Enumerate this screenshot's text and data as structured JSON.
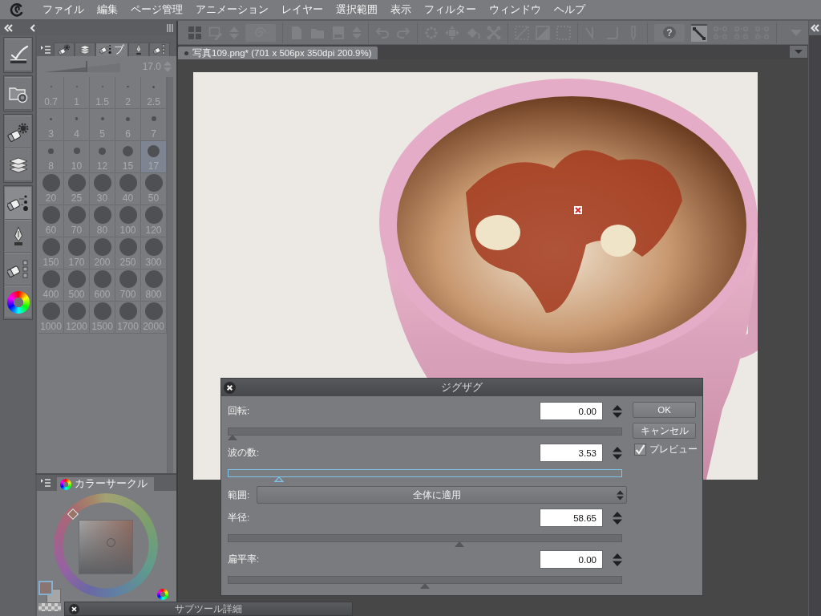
{
  "menu_bar": {
    "items": [
      "ファイル",
      "編集",
      "ページ管理",
      "アニメーション",
      "レイヤー",
      "選択範囲",
      "表示",
      "フィルター",
      "ウィンドウ",
      "ヘルプ"
    ]
  },
  "toolbar": {
    "groups": [
      {
        "items": [
          {
            "kind": "grid",
            "disabled": false
          },
          {
            "kind": "transform",
            "disabled": true
          },
          {
            "kind": "updown",
            "disabled": true
          },
          {
            "kind": "spiral",
            "disabled": true
          }
        ]
      },
      {
        "items": [
          {
            "kind": "new",
            "disabled": true
          },
          {
            "kind": "open",
            "disabled": true
          },
          {
            "kind": "save",
            "disabled": true
          },
          {
            "kind": "updown",
            "disabled": true
          }
        ]
      },
      {
        "items": [
          {
            "kind": "undo",
            "disabled": true
          },
          {
            "kind": "redo",
            "disabled": true
          }
        ]
      },
      {
        "items": [
          {
            "kind": "dots",
            "disabled": true
          },
          {
            "kind": "move",
            "disabled": true
          },
          {
            "kind": "bucket",
            "disabled": true
          },
          {
            "kind": "xshape",
            "disabled": true
          }
        ]
      },
      {
        "items": [
          {
            "kind": "dotted-diagonal",
            "disabled": true
          },
          {
            "kind": "diagonal",
            "disabled": true
          },
          {
            "kind": "dotted-square",
            "disabled": true
          }
        ]
      },
      {
        "items": [
          {
            "kind": "angle",
            "disabled": true
          },
          {
            "kind": "corner",
            "disabled": true
          },
          {
            "kind": "pen",
            "disabled": true
          }
        ]
      },
      {
        "items": [
          {
            "kind": "help",
            "label": "?",
            "disabled": true
          },
          {
            "kind": "line",
            "disabled": false
          },
          {
            "kind": "nodes",
            "disabled": true
          },
          {
            "kind": "nodes",
            "disabled": true
          },
          {
            "kind": "nodes",
            "disabled": true
          }
        ]
      }
    ]
  },
  "document_tab": {
    "title": "写真109.png* (701 x 506px 350dpi 200.9%)"
  },
  "tool_strip": {
    "groups": [
      {
        "items": [
          {
            "kind": "check-pen",
            "selected": false
          }
        ]
      },
      {
        "items": [
          {
            "kind": "folder-camera",
            "selected": false
          }
        ]
      },
      {
        "items": [
          {
            "kind": "eraser-gear",
            "selected": false
          },
          {
            "kind": "layers",
            "selected": false
          }
        ]
      },
      {
        "items": [
          {
            "kind": "brush-dots",
            "selected": true
          },
          {
            "kind": "pen-nib",
            "selected": false
          },
          {
            "kind": "eraser-boxes",
            "selected": false
          },
          {
            "kind": "color-wheel",
            "selected": false
          }
        ]
      }
    ]
  },
  "brush_size_panel": {
    "tabs": [
      {
        "kind": "eraser-gear",
        "selected": false
      },
      {
        "kind": "layers",
        "selected": false
      },
      {
        "kind": "brush-dots",
        "label": "ブ",
        "selected": true
      },
      {
        "kind": "pen-nib",
        "selected": false
      },
      {
        "kind": "eraser-boxes",
        "selected": false
      }
    ],
    "slider": {
      "level": 0.56,
      "value": "17.0"
    },
    "sizes": [
      {
        "label": "0.7",
        "selected": false
      },
      {
        "label": "1",
        "selected": false
      },
      {
        "label": "1.5",
        "selected": false
      },
      {
        "label": "2",
        "selected": false
      },
      {
        "label": "2.5",
        "selected": false
      },
      {
        "label": "3",
        "selected": false
      },
      {
        "label": "4",
        "selected": false
      },
      {
        "label": "5",
        "selected": false
      },
      {
        "label": "6",
        "selected": false
      },
      {
        "label": "7",
        "selected": false
      },
      {
        "label": "8",
        "selected": false
      },
      {
        "label": "10",
        "selected": false
      },
      {
        "label": "12",
        "selected": false
      },
      {
        "label": "15",
        "selected": false
      },
      {
        "label": "17",
        "selected": true
      },
      {
        "label": "20",
        "selected": false
      },
      {
        "label": "25",
        "selected": false
      },
      {
        "label": "30",
        "selected": false
      },
      {
        "label": "40",
        "selected": false
      },
      {
        "label": "50",
        "selected": false
      },
      {
        "label": "60",
        "selected": false
      },
      {
        "label": "70",
        "selected": false
      },
      {
        "label": "80",
        "selected": false
      },
      {
        "label": "100",
        "selected": false
      },
      {
        "label": "120",
        "selected": false
      },
      {
        "label": "150",
        "selected": false
      },
      {
        "label": "170",
        "selected": false
      },
      {
        "label": "200",
        "selected": false
      },
      {
        "label": "250",
        "selected": false
      },
      {
        "label": "300",
        "selected": false
      },
      {
        "label": "400",
        "selected": false
      },
      {
        "label": "500",
        "selected": false
      },
      {
        "label": "600",
        "selected": false
      },
      {
        "label": "700",
        "selected": false
      },
      {
        "label": "800",
        "selected": false
      },
      {
        "label": "1000",
        "selected": false
      },
      {
        "label": "1200",
        "selected": false
      },
      {
        "label": "1500",
        "selected": false
      },
      {
        "label": "1700",
        "selected": false
      },
      {
        "label": "2000",
        "selected": false
      }
    ]
  },
  "color_panel": {
    "tab": {
      "label": "カラーサークル"
    },
    "swatches": [
      {
        "kind": "main",
        "color": "#8b7570",
        "selected": true
      },
      {
        "kind": "sub",
        "color": "#a6a6a6",
        "selected": false
      },
      {
        "kind": "transparent",
        "selected": false
      }
    ]
  },
  "dialog": {
    "title": "ジグザグ",
    "params": [
      {
        "kind": "number",
        "label": "回転:",
        "value": "0.00",
        "level": 0,
        "focused": false
      },
      {
        "kind": "number",
        "label": "波の数:",
        "value": "3.53",
        "level": 0.12,
        "focused": true
      },
      {
        "kind": "select",
        "label": "範囲:",
        "value": "全体に適用"
      },
      {
        "kind": "number",
        "label": "半径:",
        "value": "58.65",
        "level": 0.59,
        "focused": false
      },
      {
        "kind": "number",
        "label": "扁平率:",
        "value": "0.00",
        "level": 0.5,
        "focused": false
      }
    ],
    "buttons": [
      "OK",
      "キャンセル"
    ],
    "preview": {
      "label": "プレビュー",
      "checked": true
    }
  },
  "sub_tool_panel": {
    "title": "サブツール詳細"
  }
}
